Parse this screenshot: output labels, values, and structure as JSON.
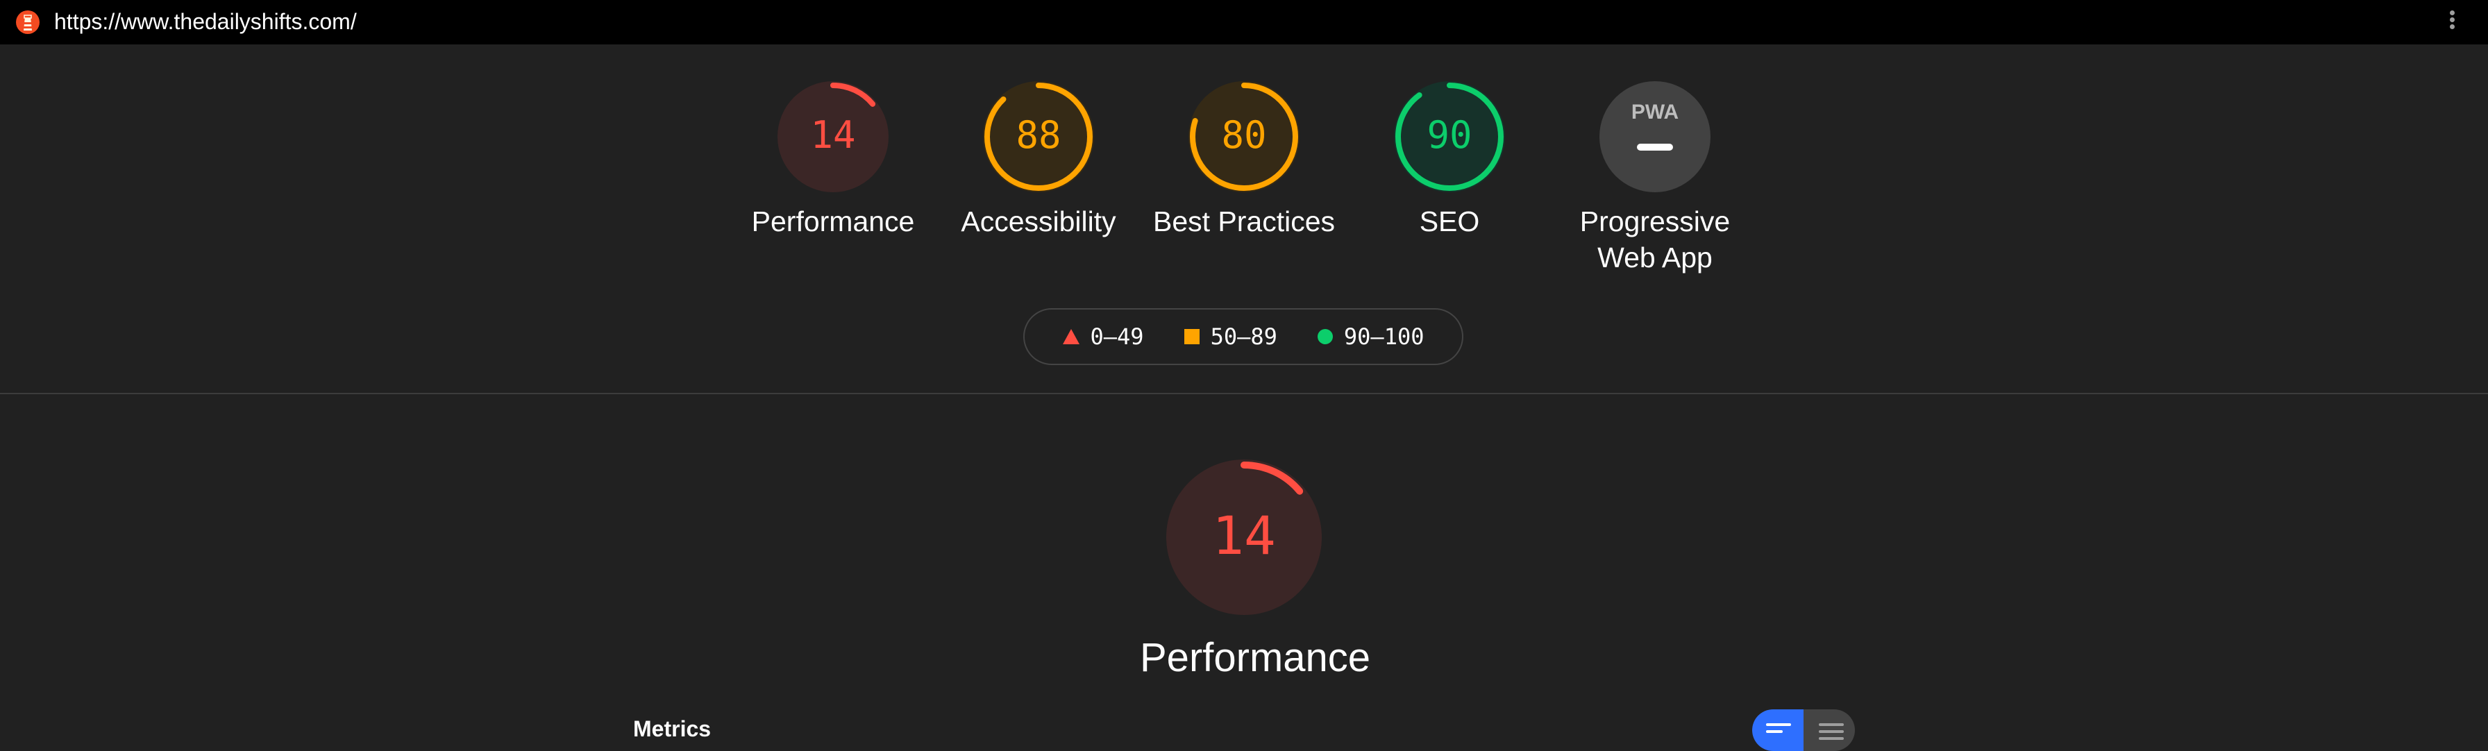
{
  "browser": {
    "url": "https://www.thedailyshifts.com/",
    "logo_icon": "lighthouse-icon",
    "menu_icon": "more-vert-icon"
  },
  "gauges": [
    {
      "id": "performance",
      "score": "14",
      "label": "Performance",
      "fraction": 0.14,
      "color": "#ff4e42",
      "bg": "#3b2626"
    },
    {
      "id": "accessibility",
      "score": "88",
      "label": "Accessibility",
      "fraction": 0.88,
      "color": "#ffa400",
      "bg": "#352a16"
    },
    {
      "id": "best-practices",
      "score": "80",
      "label": "Best Practices",
      "fraction": 0.8,
      "color": "#ffa400",
      "bg": "#352a16"
    },
    {
      "id": "seo",
      "score": "90",
      "label": "SEO",
      "fraction": 0.9,
      "color": "#0cce6b",
      "bg": "#16322a"
    }
  ],
  "pwa": {
    "badge": "PWA",
    "label_line1": "Progressive",
    "label_line2": "Web App",
    "bg": "#424242"
  },
  "legend": [
    {
      "shape": "triangle",
      "range": "0–49",
      "color": "#ff4e42"
    },
    {
      "shape": "square",
      "range": "50–89",
      "color": "#ffa400"
    },
    {
      "shape": "circle",
      "range": "90–100",
      "color": "#0cce6b"
    }
  ],
  "performance_section": {
    "score": "14",
    "fraction": 0.14,
    "label": "Performance",
    "color": "#ff4e42",
    "bg": "#3b2626"
  },
  "metrics": {
    "title": "Metrics",
    "toggle_left_icon": "compact-view-icon",
    "toggle_right_icon": "expanded-view-icon"
  }
}
